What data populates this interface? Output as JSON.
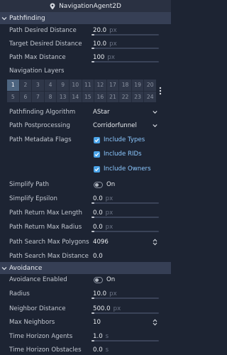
{
  "title": "NavigationAgent2D",
  "sections": {
    "pathfinding": "Pathfinding",
    "avoidance": "Avoidance"
  },
  "pathfinding": {
    "path_desired_distance": {
      "label": "Path Desired Distance",
      "value": "20.0",
      "unit": "px"
    },
    "target_desired_distance": {
      "label": "Target Desired Distance",
      "value": "10.0",
      "unit": "px"
    },
    "path_max_distance": {
      "label": "Path Max Distance",
      "value": "100",
      "unit": "px"
    },
    "navigation_layers": {
      "label": "Navigation Layers",
      "layers": [
        "1",
        "2",
        "3",
        "4",
        "9",
        "10",
        "11",
        "12",
        "17",
        "18",
        "19",
        "20",
        "5",
        "6",
        "7",
        "8",
        "13",
        "14",
        "15",
        "16",
        "21",
        "22",
        "23",
        "24"
      ],
      "enabled": [
        "1"
      ]
    },
    "pathfinding_algorithm": {
      "label": "Pathfinding Algorithm",
      "value": "AStar"
    },
    "path_postprocessing": {
      "label": "Path Postprocessing",
      "value": "Corridorfunnel"
    },
    "path_metadata_flags": {
      "label": "Path Metadata Flags",
      "options": [
        "Include Types",
        "Include RIDs",
        "Include Owners"
      ]
    },
    "simplify_path": {
      "label": "Simplify Path",
      "value": "On"
    },
    "simplify_epsilon": {
      "label": "Simplify Epsilon",
      "value": "0.0",
      "unit": "px"
    },
    "path_return_max_length": {
      "label": "Path Return Max Length",
      "value": "0.0",
      "unit": "px"
    },
    "path_return_max_radius": {
      "label": "Path Return Max Radius",
      "value": "0.0",
      "unit": "px"
    },
    "path_search_max_polygons": {
      "label": "Path Search Max Polygons",
      "value": "4096"
    },
    "path_search_max_distance": {
      "label": "Path Search Max Distance",
      "value": "0.0"
    }
  },
  "avoidance": {
    "avoidance_enabled": {
      "label": "Avoidance Enabled",
      "value": "On"
    },
    "radius": {
      "label": "Radius",
      "value": "10.0",
      "unit": "px"
    },
    "neighbor_distance": {
      "label": "Neighbor Distance",
      "value": "500.0",
      "unit": "px"
    },
    "max_neighbors": {
      "label": "Max Neighbors",
      "value": "10"
    },
    "time_horizon_agents": {
      "label": "Time Horizon Agents",
      "value": "1.0",
      "unit": "s"
    },
    "time_horizon_obstacles": {
      "label": "Time Horizon Obstacles",
      "value": "0.0",
      "unit": "s"
    }
  },
  "colors": {
    "background": "#1d2433",
    "section_header": "#363f55",
    "accent": "#4aa3e8",
    "layer_enabled": "#4d6580"
  },
  "icons": {
    "title": "node-pin-icon",
    "section": "chevron-down-icon",
    "layers_menu": "kebab-menu-icon"
  }
}
